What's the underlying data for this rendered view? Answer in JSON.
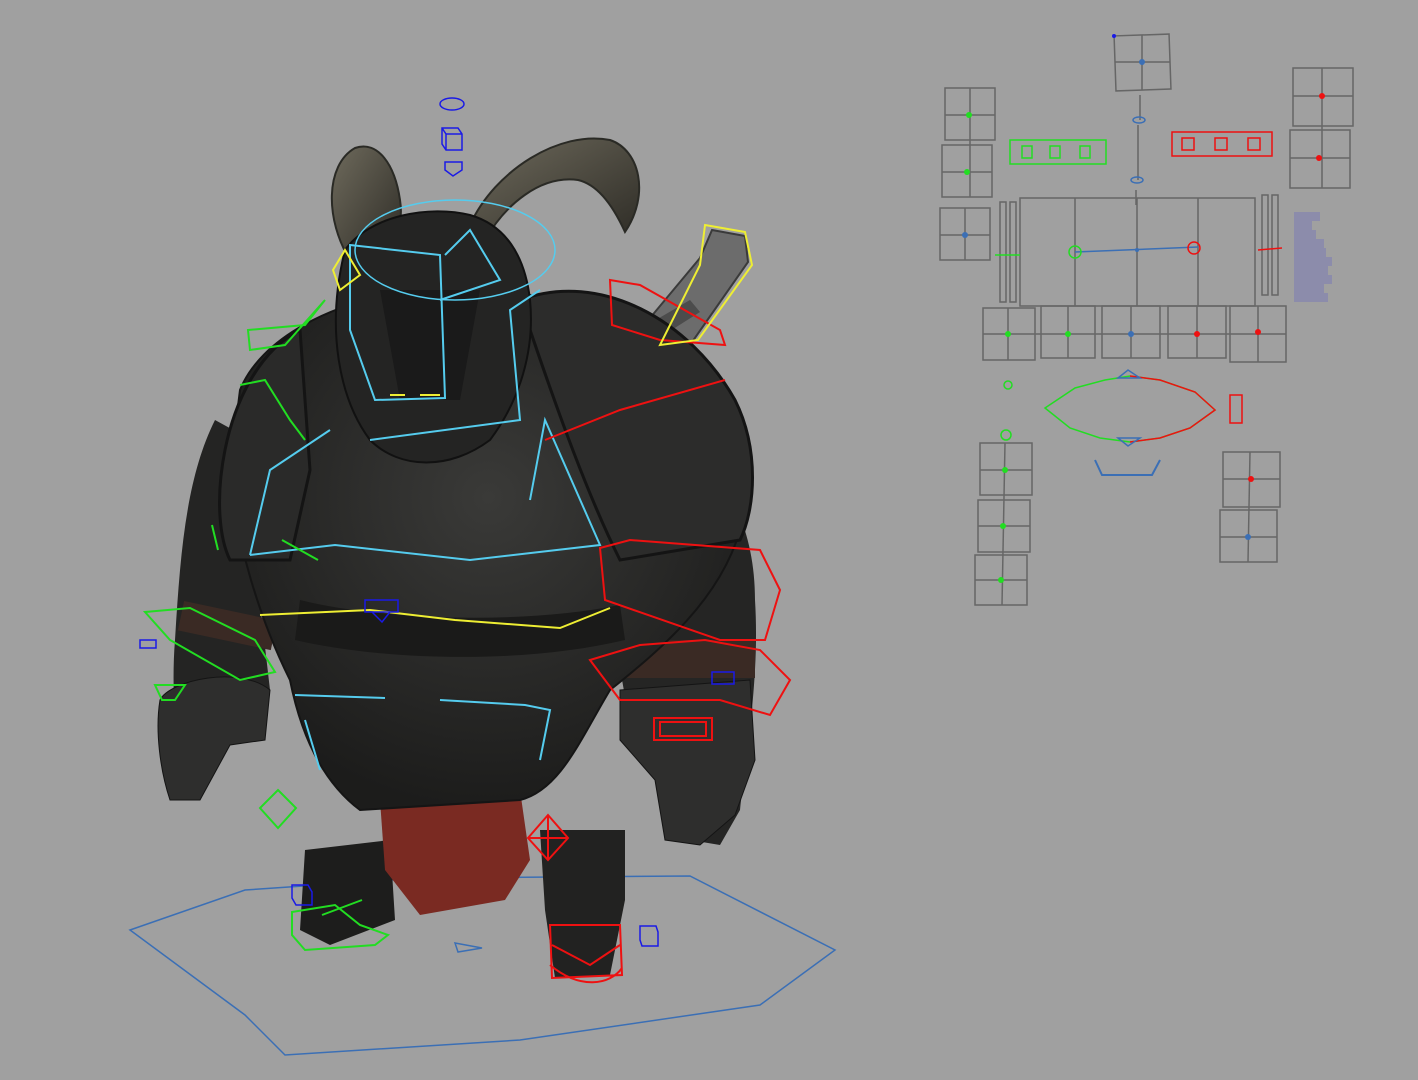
{
  "viewport": {
    "background": "#a0a0a0",
    "character": "character-mesh"
  },
  "colors": {
    "left_side": "#22dd22",
    "right_side": "#ee1111",
    "center": "#1a1ae6",
    "fk": "#55ccee",
    "selection": "#eeee33",
    "picker_frame": "#666666",
    "ground": "#3b6fb5"
  },
  "picker": {
    "labels": [
      "",
      "",
      "",
      "",
      "",
      "",
      "",
      "",
      "",
      ""
    ]
  }
}
